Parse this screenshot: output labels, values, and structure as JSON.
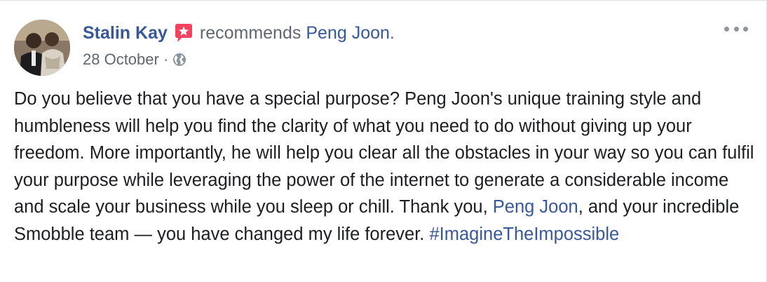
{
  "post": {
    "author": "Stalin Kay",
    "recommend_verb": "recommends",
    "recommended_page": "Peng Joon",
    "recommend_period": ".",
    "date": "28 October",
    "meta_separator": "·",
    "privacy_icon": "globe-icon",
    "more_icon": "more-options-icon",
    "recommend_icon": "recommendation-star-icon",
    "body": {
      "part1": "Do you believe that you have a special purpose? Peng Joon's unique training style and humbleness will help you find the clarity of what you need to do without giving up your freedom. More importantly, he will help you clear all the obstacles in your way so you can fulfil your purpose while leveraging the power of the internet to generate a considerable income and scale your business while you sleep or chill. Thank you, ",
      "mention": "Peng Joon",
      "part2": ", and your incredible Smobble team  — you have changed my life forever. ",
      "hashtag": "#ImagineTheImpossible"
    }
  },
  "colors": {
    "link": "#385898",
    "secondary_text": "#606770",
    "body_text": "#1c1e21",
    "recommend_icon": "#f3425f"
  }
}
